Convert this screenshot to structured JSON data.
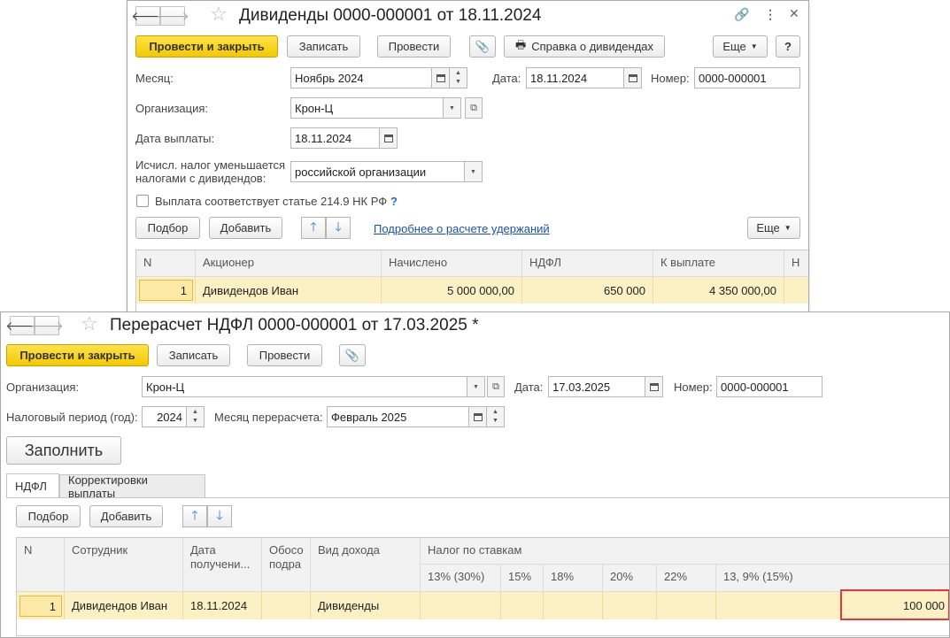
{
  "window1": {
    "title": "Дивиденды 0000-000001 от 18.11.2024",
    "toolbar": {
      "post_close": "Провести и закрыть",
      "write": "Записать",
      "post": "Провести",
      "report": "Справка о дивидендах",
      "more": "Еще",
      "help": "?"
    },
    "month_label": "Месяц:",
    "month_value": "Ноябрь 2024",
    "date_label": "Дата:",
    "date_value": "18.11.2024",
    "number_label": "Номер:",
    "number_value": "0000-000001",
    "org_label": "Организация:",
    "org_value": "Крон-Ц",
    "pay_date_label": "Дата выплаты:",
    "pay_date_value": "18.11.2024",
    "tax_reduce_label_1": "Исчисл. налог уменьшается",
    "tax_reduce_label_2": "налогами с дивидендов:",
    "tax_reduce_value": "российской организации",
    "checkbox_label": "Выплата соответствует статье 214.9 НК РФ",
    "checkbox_checked": false,
    "help_mark": "?",
    "table_toolbar": {
      "select": "Подбор",
      "add": "Добавить",
      "details_link": "Подробнее о расчете удержаний",
      "more": "Еще"
    },
    "table": {
      "headers": [
        "N",
        "Акционер",
        "Начислено",
        "НДФЛ",
        "К выплате",
        "Н"
      ],
      "rows": [
        [
          "1",
          "Дивидендов Иван",
          "5 000 000,00",
          "650 000",
          "4 350 000,00",
          ""
        ]
      ]
    }
  },
  "window2": {
    "title": "Перерасчет НДФЛ 0000-000001 от 17.03.2025 *",
    "toolbar": {
      "post_close": "Провести и закрыть",
      "write": "Записать",
      "post": "Провести"
    },
    "org_label": "Организация:",
    "org_value": "Крон-Ц",
    "date_label": "Дата:",
    "date_value": "17.03.2025",
    "number_label": "Номер:",
    "number_value": "0000-000001",
    "tax_period_label": "Налоговый период (год):",
    "tax_period_value": "2024",
    "recalc_month_label": "Месяц перерасчета:",
    "recalc_month_value": "Февраль 2025",
    "fill_button": "Заполнить",
    "tabs": [
      "НДФЛ",
      "Корректировки выплаты"
    ],
    "table_toolbar": {
      "select": "Подбор",
      "add": "Добавить"
    },
    "table": {
      "headers": {
        "n": "N",
        "employee": "Сотрудник",
        "date_1": "Дата",
        "date_2": "получени...",
        "basis_1": "Обосо",
        "basis_2": "подра",
        "income_type": "Вид дохода",
        "tax_by_rates": "Налог по ставкам",
        "rates": [
          "13% (30%)",
          "15%",
          "18%",
          "20%",
          "22%",
          "13, 9% (15%)"
        ]
      },
      "rows": [
        {
          "n": "1",
          "employee": "Дивидендов Иван",
          "date": "18.11.2024",
          "basis": "",
          "income_type": "Дивиденды",
          "rates": [
            "",
            "",
            "",
            "",
            "",
            ""
          ],
          "highlighted_value": "100 000"
        }
      ]
    }
  }
}
